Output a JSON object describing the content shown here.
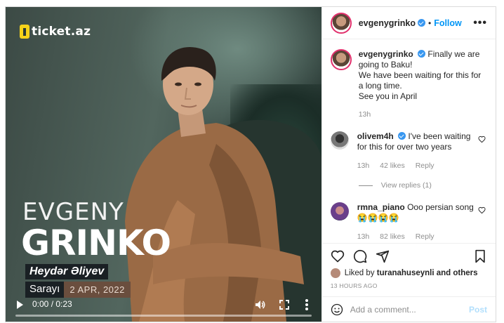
{
  "media": {
    "logo_text": "ticket.az",
    "title_line1": "EVGENY",
    "title_line2": "GRINKO",
    "venue_line1": "Heydər Əliyev",
    "venue_line2": "Sarayı",
    "date": "2 APR, 2022",
    "video_time": "0:00 / 0:23",
    "progress": 0
  },
  "header": {
    "username": "evgenygrinko",
    "separator": "•",
    "follow_label": "Follow",
    "more_label": "•••"
  },
  "caption": {
    "username": "evgenygrinko",
    "text_line1": "Finally we are going to Baku!",
    "text_line2": "We have been waiting for this for a long time.",
    "text_line3": "See you in April",
    "time": "13h"
  },
  "comments": [
    {
      "username": "olivem4h",
      "text": "I've been waiting for this for over two years",
      "time": "13h",
      "likes": "42 likes",
      "reply_label": "Reply",
      "view_replies": "View replies (1)"
    },
    {
      "username": "rmna_piano",
      "text": "Ooo persian song😭😭😭😭",
      "time": "13h",
      "likes": "82 likes",
      "reply_label": "Reply"
    }
  ],
  "likes": {
    "prefix": "Liked by",
    "user": "turanahuseynli",
    "suffix": "and others"
  },
  "post_time": "13 HOURS AGO",
  "add_comment": {
    "placeholder": "Add a comment...",
    "post_label": "Post"
  },
  "icons": [
    "heart-icon",
    "comment-icon",
    "share-icon",
    "bookmark-icon",
    "emoji-icon",
    "play-icon",
    "volume-icon",
    "fullscreen-icon",
    "more-vert-icon",
    "verified-icon"
  ],
  "colors": {
    "accent": "#0095f6",
    "verified": "#3897f0",
    "muted": "#8e8e8e",
    "logo_yellow": "#f6d21a",
    "date_bg": "#6a4e3e"
  }
}
